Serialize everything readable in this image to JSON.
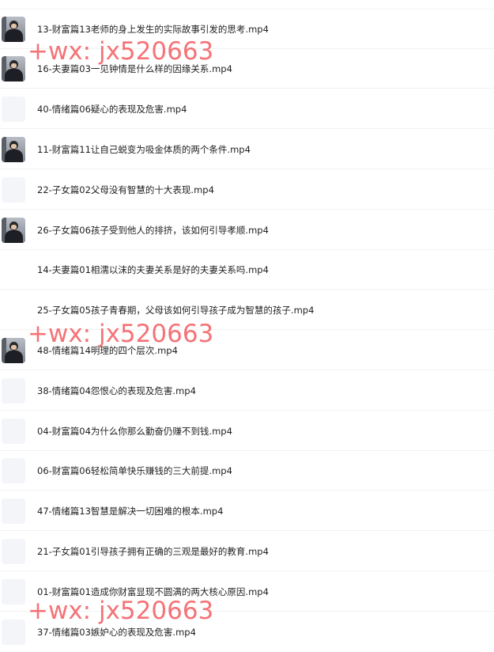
{
  "files": [
    {
      "name": "13-财富篇13老师的身上发生的实际故事引发的思考.mp4",
      "thumb": "photo"
    },
    {
      "name": "16-夫妻篇03一见钟情是什么样的因缘关系.mp4",
      "thumb": "photo"
    },
    {
      "name": "40-情绪篇06疑心的表现及危害.mp4",
      "thumb": "blank-light"
    },
    {
      "name": "11-财富篇11让自己蜕变为吸金体质的两个条件.mp4",
      "thumb": "photo"
    },
    {
      "name": "22-子女篇02父母没有智慧的十大表现.mp4",
      "thumb": "blank-light"
    },
    {
      "name": "26-子女篇06孩子受到他人的排挤，该如何引导孝顺.mp4",
      "thumb": "photo"
    },
    {
      "name": "14-夫妻篇01相濡以沫的夫妻关系是好的夫妻关系吗.mp4",
      "thumb": "none"
    },
    {
      "name": "25-子女篇05孩子青春期，父母该如何引导孩子成为智慧的孩子.mp4",
      "thumb": "none"
    },
    {
      "name": "48-情绪篇14明理的四个层次.mp4",
      "thumb": "photo"
    },
    {
      "name": "38-情绪篇04怨恨心的表现及危害.mp4",
      "thumb": "blank-light"
    },
    {
      "name": "04-财富篇04为什么你那么勤奋仍赚不到钱.mp4",
      "thumb": "blank-light"
    },
    {
      "name": "06-财富篇06轻松简单快乐赚钱的三大前提.mp4",
      "thumb": "blank-light"
    },
    {
      "name": "47-情绪篇13智慧是解决一切困难的根本.mp4",
      "thumb": "blank-light"
    },
    {
      "name": "21-子女篇01引导孩子拥有正确的三观是最好的教育.mp4",
      "thumb": "blank-light"
    },
    {
      "name": "01-财富篇01造成你财富显现不圆满的两大核心原因.mp4",
      "thumb": "blank-light"
    },
    {
      "name": "37-情绪篇03嫉妒心的表现及危害.mp4",
      "thumb": "blank-light"
    }
  ],
  "watermark": "+wx: jx520663"
}
